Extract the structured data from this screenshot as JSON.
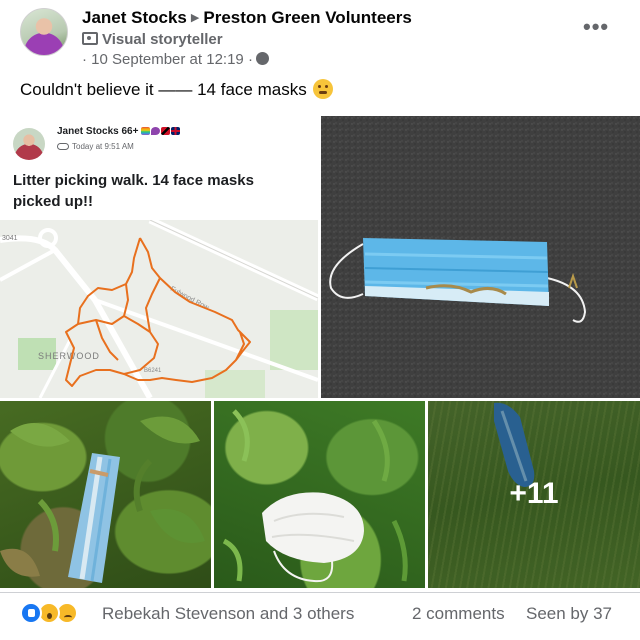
{
  "post": {
    "author": "Janet Stocks",
    "group": "Preston Green Volunteers",
    "badge": "Visual storyteller",
    "timestamp": "· 10 September at 12:19 ·",
    "caption": "Couldn't believe it —— 14 face masks",
    "caption_emoji": "grimacing-face-emoji",
    "more_label": "•••"
  },
  "photos": {
    "embedded_post": {
      "author": "Janet Stocks 66+",
      "author_emojis": [
        "rainbow-emoji",
        "purple-heart-emoji",
        "trinidad-flag-emoji",
        "uk-flag-emoji"
      ],
      "time": "Today at 9:51 AM",
      "text": "Litter picking walk. 14 face masks picked up!!",
      "map": {
        "labels": {
          "area": "SHERWOOD",
          "road": "Fulwood Row"
        },
        "route_color": "#e8701e"
      }
    },
    "more_count": "+11"
  },
  "footer": {
    "reaction_icons": [
      "like-icon",
      "wow-icon",
      "sad-icon"
    ],
    "reactors": "Rebekah Stevenson and 3 others",
    "comments": "2 comments",
    "seen": "Seen by 37"
  },
  "colors": {
    "secondary_text": "#65676b",
    "like_blue": "#1877f2",
    "route_orange": "#e8701e"
  }
}
